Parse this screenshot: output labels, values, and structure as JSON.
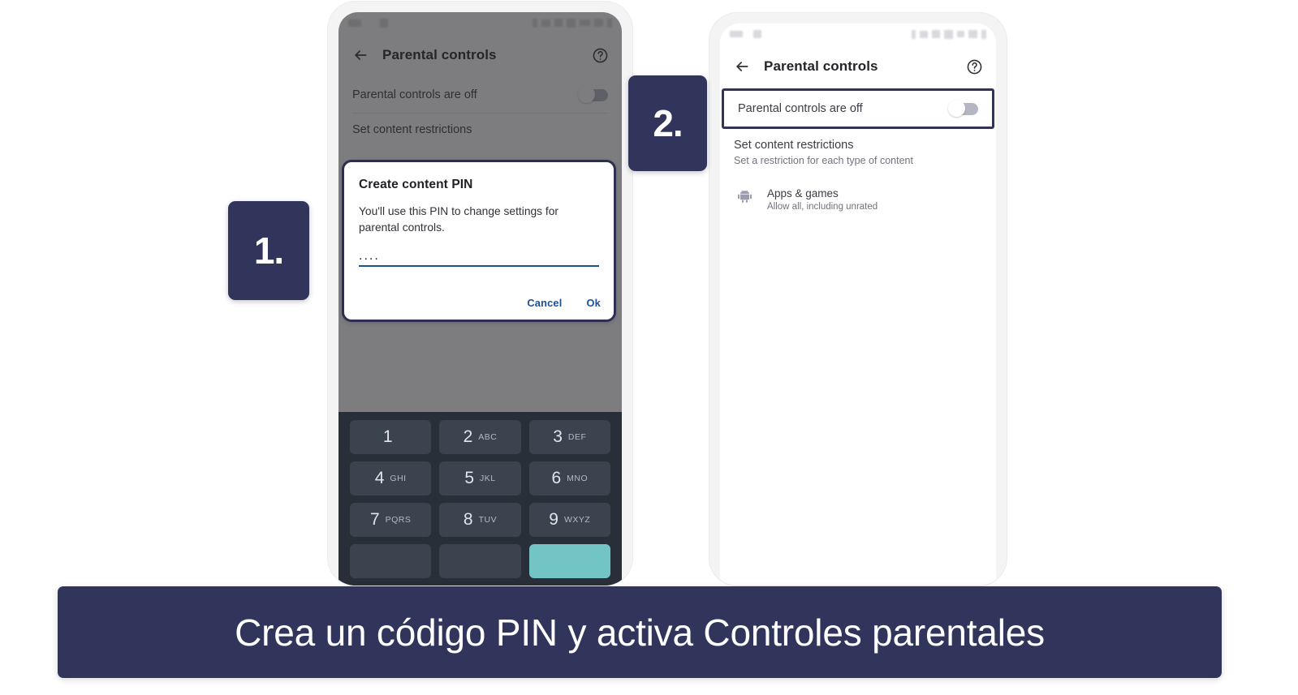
{
  "caption": {
    "text": "Crea un código PIN y activa Controles parentales"
  },
  "steps": [
    {
      "label": "1."
    },
    {
      "label": "2."
    }
  ],
  "colors": {
    "brand_navy": "#31355c",
    "dialog_border": "#2c2f52",
    "link_blue": "#1b4f9c",
    "field_underline": "#1a5492",
    "keypad_bg": "#282f39",
    "keypad_key": "#3b434e",
    "keypad_accent": "#73c5c5",
    "scrim": "rgba(39,39,42,0.60)"
  },
  "phone1": {
    "appbar": {
      "back_icon": "arrow-left-icon",
      "title": "Parental controls",
      "help_icon": "help-circle-icon"
    },
    "toggle_row": {
      "label": "Parental controls are off",
      "state": "off"
    },
    "section": {
      "title": "Set content restrictions"
    },
    "dialog": {
      "title": "Create content PIN",
      "body": "You'll use this PIN to change settings for parental controls.",
      "pin_value": "....",
      "cancel_label": "Cancel",
      "ok_label": "Ok"
    },
    "keypad": {
      "rows": [
        [
          {
            "num": "1",
            "sub": ""
          },
          {
            "num": "2",
            "sub": "ABC"
          },
          {
            "num": "3",
            "sub": "DEF"
          }
        ],
        [
          {
            "num": "4",
            "sub": "GHI"
          },
          {
            "num": "5",
            "sub": "JKL"
          },
          {
            "num": "6",
            "sub": "MNO"
          }
        ],
        [
          {
            "num": "7",
            "sub": "PQRS"
          },
          {
            "num": "8",
            "sub": "TUV"
          },
          {
            "num": "9",
            "sub": "WXYZ"
          }
        ]
      ]
    }
  },
  "phone2": {
    "appbar": {
      "back_icon": "arrow-left-icon",
      "title": "Parental controls",
      "help_icon": "help-circle-icon"
    },
    "toggle_row": {
      "label": "Parental controls are off",
      "state": "off",
      "highlighted": true
    },
    "section": {
      "title": "Set content restrictions",
      "subtitle": "Set a restriction for each type of content"
    },
    "content_items": [
      {
        "icon": "android-robot-icon",
        "title": "Apps & games",
        "subtitle": "Allow all, including unrated"
      }
    ]
  }
}
